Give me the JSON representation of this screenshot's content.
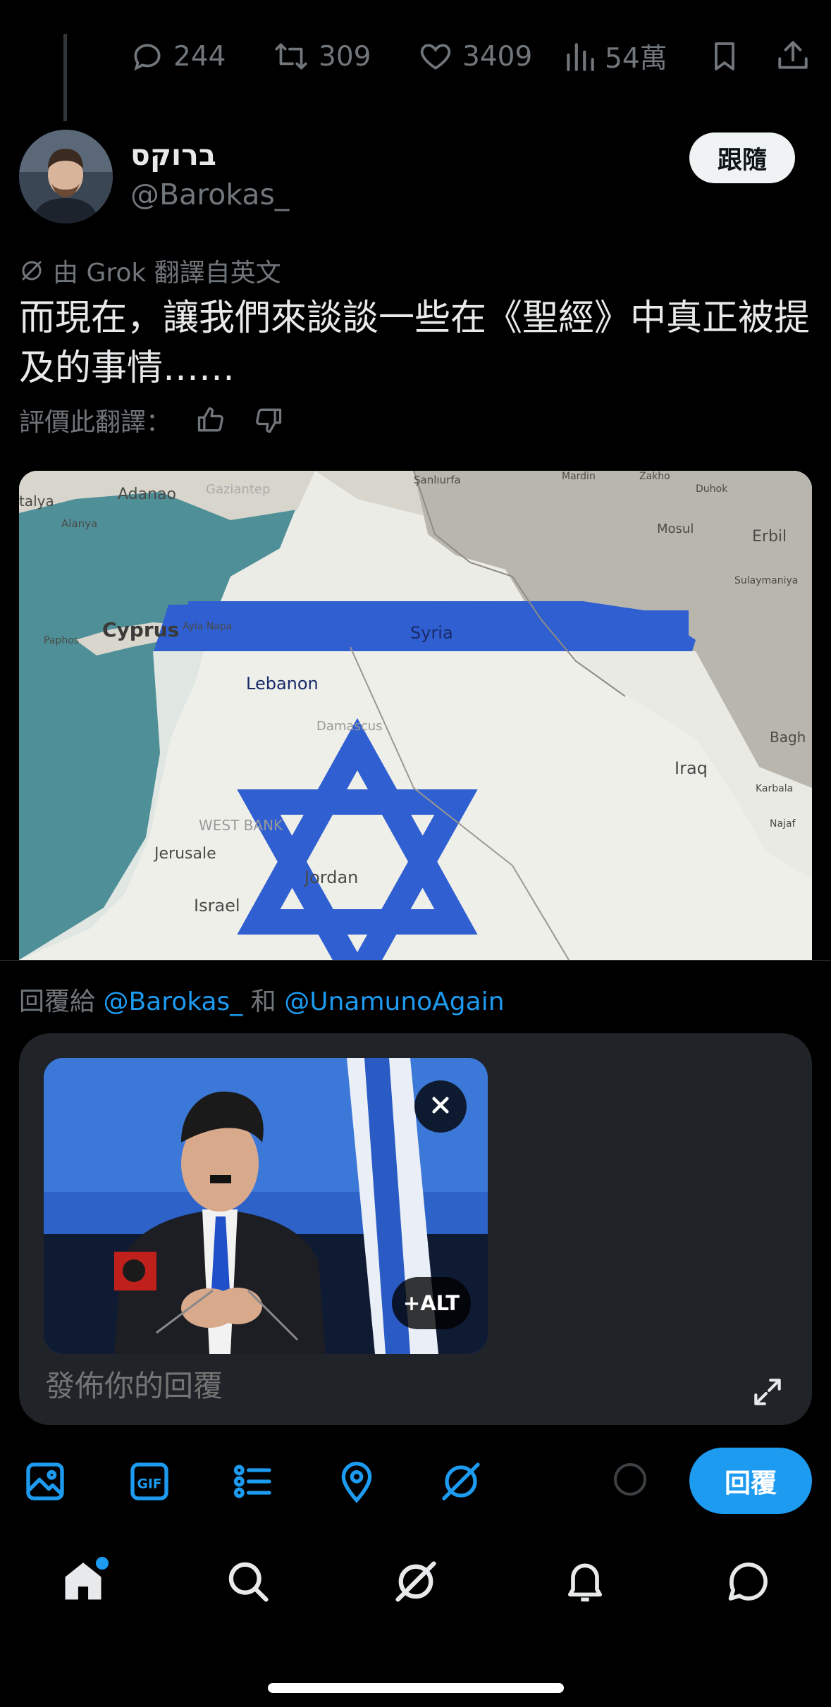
{
  "actions": {
    "replies": "244",
    "reposts": "309",
    "likes": "3409",
    "views": "54萬"
  },
  "profile": {
    "display_name": "ברוקס",
    "handle": "@Barokas_",
    "follow_label": "跟隨"
  },
  "tweet": {
    "translated_note": "由 Grok 翻譯自英文",
    "text": "而現在，讓我們來談談一些在《聖經》中真正被提及的事情……",
    "rate_label": "評價此翻譯："
  },
  "map": {
    "labels": [
      "Adanao",
      "Gaziantep",
      "Şanlıurfa",
      "Mardin",
      "Zakho",
      "Duhok",
      "Mosul",
      "Erbil",
      "Sulaymaniya",
      "Antalya",
      "Alanya",
      "Cyprus",
      "Ayia Napa",
      "Paphos",
      "Syria",
      "Lebanon",
      "Damascus",
      "Iraq",
      "Baghdad",
      "Karbala",
      "Najaf",
      "WEST BANK",
      "Jerusalem",
      "Jordan",
      "Israel"
    ]
  },
  "reply": {
    "reply_to_prefix": "回覆給",
    "mention_1": "@Barokas_",
    "conjunction": "和",
    "mention_2": "@UnamunoAgain",
    "placeholder": "發佈你的回覆",
    "alt_label": "+ALT",
    "submit_label": "回覆"
  },
  "toolbar_icons": [
    "image-icon",
    "gif-icon",
    "poll-icon",
    "location-icon",
    "grok-icon"
  ],
  "nav_icons": [
    "home-icon",
    "search-icon",
    "grok-icon",
    "notifications-icon",
    "messages-icon"
  ],
  "colors": {
    "accent": "#1d9bf0",
    "background": "#000000",
    "secondary_text": "#71767b",
    "composer_bg": "#202327",
    "flag_blue": "#2f5fd0"
  }
}
